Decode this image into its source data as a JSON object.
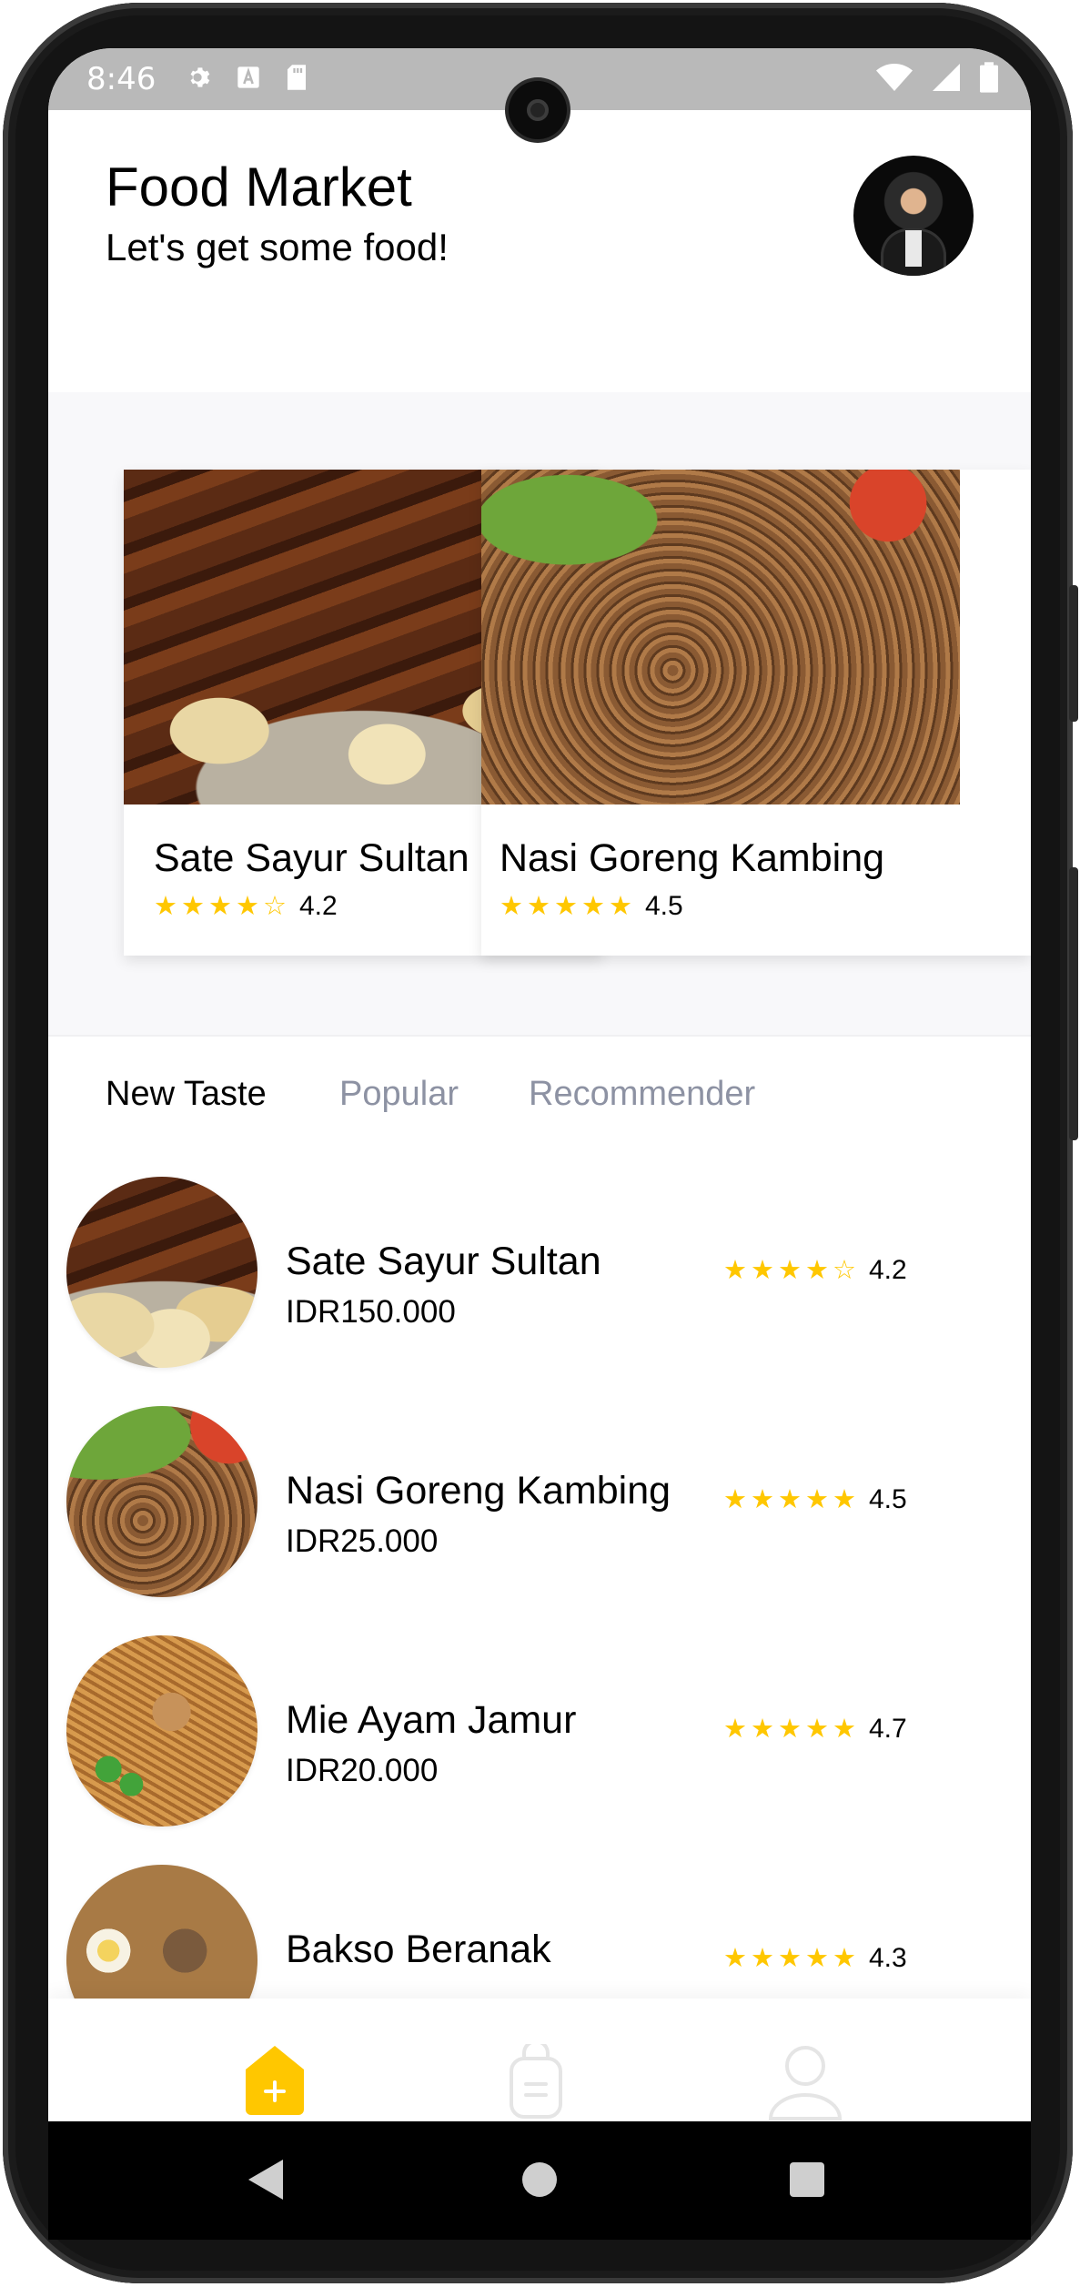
{
  "status_bar": {
    "time": "8:46",
    "left_icons": [
      "gear-icon",
      "a-letter-icon",
      "sd-card-icon"
    ],
    "right_icons": [
      "wifi-icon",
      "cell-signal-icon",
      "battery-icon"
    ]
  },
  "header": {
    "title": "Food Market",
    "subtitle": "Let's get some food!"
  },
  "featured": [
    {
      "name": "Sate Sayur Sultan",
      "rating": 4.2,
      "rating_label": "4.2",
      "stars": [
        "full",
        "full",
        "full",
        "full",
        "empty"
      ]
    },
    {
      "name": "Nasi Goreng Kambing",
      "rating": 4.5,
      "rating_label": "4.5",
      "stars": [
        "full",
        "full",
        "full",
        "full",
        "full"
      ]
    }
  ],
  "tabs": [
    {
      "label": "New Taste",
      "active": true
    },
    {
      "label": "Popular",
      "active": false
    },
    {
      "label": "Recommender",
      "active": false
    }
  ],
  "list": [
    {
      "name": "Sate Sayur Sultan",
      "price": "IDR150.000",
      "rating_label": "4.2",
      "stars": [
        "full",
        "full",
        "full",
        "full",
        "empty"
      ]
    },
    {
      "name": "Nasi Goreng Kambing",
      "price": "IDR25.000",
      "rating_label": "4.5",
      "stars": [
        "full",
        "full",
        "full",
        "full",
        "full"
      ]
    },
    {
      "name": "Mie Ayam Jamur",
      "price": "IDR20.000",
      "rating_label": "4.7",
      "stars": [
        "full",
        "full",
        "full",
        "full",
        "full"
      ]
    },
    {
      "name": "Bakso Beranak",
      "price": "",
      "rating_label": "4.3",
      "stars": [
        "full",
        "full",
        "full",
        "full",
        "full"
      ]
    }
  ],
  "bottom_nav": [
    {
      "icon": "home-icon",
      "active": true
    },
    {
      "icon": "order-bag-icon",
      "active": false
    },
    {
      "icon": "profile-icon",
      "active": false
    }
  ],
  "colors": {
    "accent": "#FFC700",
    "text_primary": "#020202",
    "text_secondary": "#8D92A3",
    "section_bg": "#F8F8FA",
    "nav_inactive": "#E5E5E5"
  },
  "system_nav": [
    "back-icon",
    "home-circle-icon",
    "recents-icon"
  ]
}
